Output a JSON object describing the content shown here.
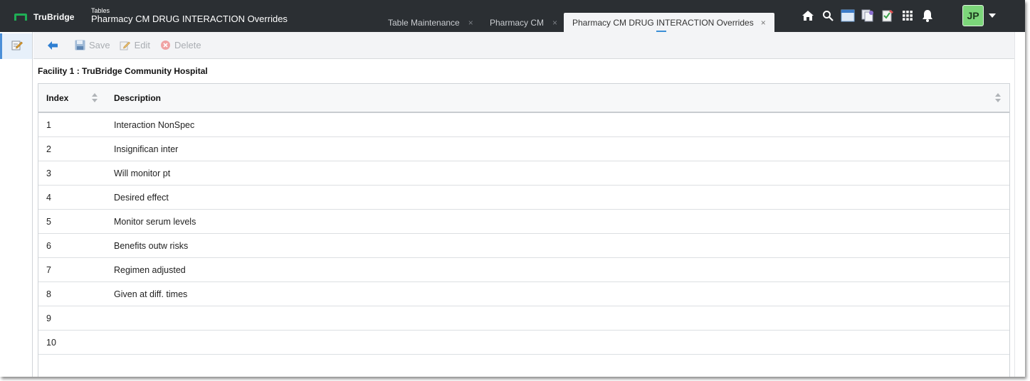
{
  "header": {
    "logo_text": "TruBridge",
    "breadcrumb": "Tables",
    "title": "Pharmacy CM DRUG INTERACTION Overrides",
    "tabs": [
      {
        "label": "Table Maintenance",
        "close": "×"
      },
      {
        "label": "Pharmacy CM",
        "close": "×"
      },
      {
        "label": "Pharmacy CM DRUG INTERACTION Overrides",
        "close": "×"
      }
    ],
    "user_initials": "JP",
    "icons": [
      "home-icon",
      "search-icon",
      "window-icon",
      "documents-icon",
      "checklist-icon",
      "apps-grid-icon",
      "bell-icon"
    ]
  },
  "toolbar": {
    "save_label": "Save",
    "edit_label": "Edit",
    "delete_label": "Delete"
  },
  "content": {
    "facility_label": "Facility 1 : TruBridge Community Hospital",
    "columns": {
      "index": "Index",
      "description": "Description"
    },
    "rows": [
      {
        "index": "1",
        "description": "Interaction NonSpec"
      },
      {
        "index": "2",
        "description": "Insignifican inter"
      },
      {
        "index": "3",
        "description": "Will monitor pt"
      },
      {
        "index": "4",
        "description": "Desired effect"
      },
      {
        "index": "5",
        "description": "Monitor serum levels"
      },
      {
        "index": "6",
        "description": "Benefits outw risks"
      },
      {
        "index": "7",
        "description": "Regimen adjusted"
      },
      {
        "index": "8",
        "description": "Given at diff. times"
      },
      {
        "index": "9",
        "description": ""
      },
      {
        "index": "10",
        "description": ""
      }
    ]
  },
  "colors": {
    "topbar": "#2b2f33",
    "accent": "#3c8fd6",
    "avatar": "#7cd67a",
    "logo_green": "#1fae55"
  }
}
